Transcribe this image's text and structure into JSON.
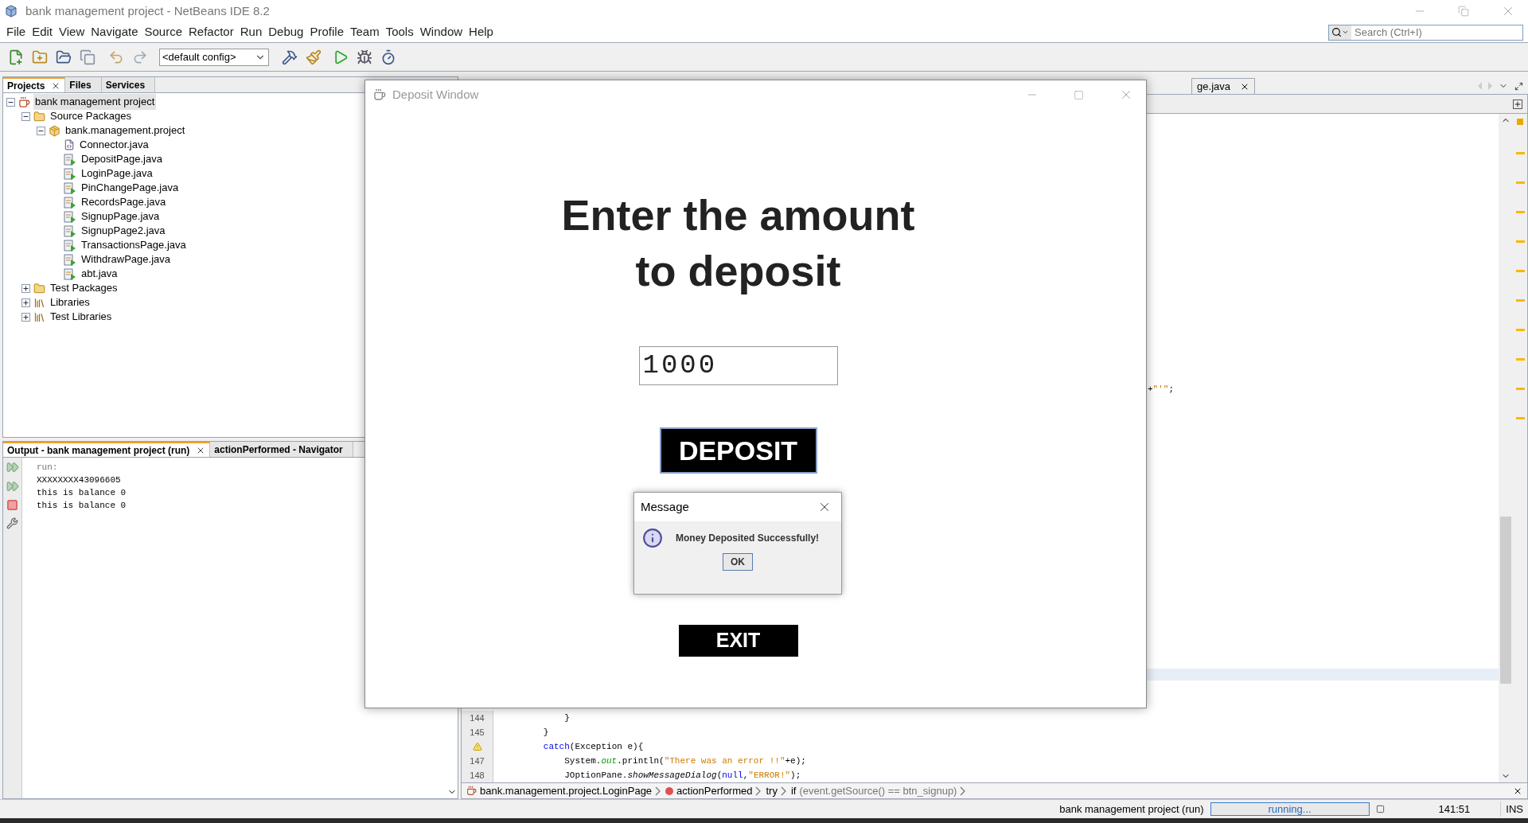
{
  "window": {
    "title": "bank management project - NetBeans IDE 8.2"
  },
  "menu": [
    "File",
    "Edit",
    "View",
    "Navigate",
    "Source",
    "Refactor",
    "Run",
    "Debug",
    "Profile",
    "Team",
    "Tools",
    "Window",
    "Help"
  ],
  "search": {
    "placeholder": "Search (Ctrl+I)"
  },
  "toolbar": {
    "config": "<default config>"
  },
  "projects_panel": {
    "tabs": [
      {
        "label": "Projects",
        "selected": true
      },
      {
        "label": "Files",
        "selected": false
      },
      {
        "label": "Services",
        "selected": false
      }
    ],
    "tree": [
      {
        "label": "bank management project",
        "kind": "project",
        "selected": true,
        "expanded": true,
        "children": [
          {
            "label": "Source Packages",
            "kind": "source-folder",
            "selected": false,
            "expanded": true,
            "children": [
              {
                "label": "bank.management.project",
                "kind": "package",
                "selected": false,
                "expanded": true,
                "children": [
                  {
                    "label": "Connector.java",
                    "kind": "class",
                    "selected": false
                  },
                  {
                    "label": "DepositPage.java",
                    "kind": "main-class",
                    "selected": false
                  },
                  {
                    "label": "LoginPage.java",
                    "kind": "main-class",
                    "selected": false
                  },
                  {
                    "label": "PinChangePage.java",
                    "kind": "main-class",
                    "selected": false
                  },
                  {
                    "label": "RecordsPage.java",
                    "kind": "main-class",
                    "selected": false
                  },
                  {
                    "label": "SignupPage.java",
                    "kind": "main-class",
                    "selected": false
                  },
                  {
                    "label": "SignupPage2.java",
                    "kind": "main-class",
                    "selected": false
                  },
                  {
                    "label": "TransactionsPage.java",
                    "kind": "main-class",
                    "selected": false
                  },
                  {
                    "label": "WithdrawPage.java",
                    "kind": "main-class",
                    "selected": false
                  },
                  {
                    "label": "abt.java",
                    "kind": "main-class",
                    "selected": false
                  }
                ]
              }
            ]
          },
          {
            "label": "Test Packages",
            "kind": "source-folder",
            "selected": false,
            "expanded": false
          },
          {
            "label": "Libraries",
            "kind": "library",
            "selected": false,
            "expanded": false
          },
          {
            "label": "Test Libraries",
            "kind": "library",
            "selected": false,
            "expanded": false
          }
        ]
      }
    ]
  },
  "output_panel": {
    "tabs": [
      {
        "label": "Output - bank management project (run)",
        "selected": true
      },
      {
        "label": "actionPerformed - Navigator",
        "selected": false
      }
    ],
    "lines": [
      {
        "text": "run:",
        "kind": "system"
      },
      {
        "text": "XXXXXXXX43096605",
        "kind": "out"
      },
      {
        "text": "this is balance 0",
        "kind": "out"
      },
      {
        "text": "this is balance 0",
        "kind": "out"
      }
    ]
  },
  "editor": {
    "tab": {
      "label": "ge.java"
    },
    "fragment": [
      {
        "text": "+",
        "kind": "plain"
      },
      {
        "text": "\"'\"",
        "kind": "string"
      },
      {
        "text": ";",
        "kind": "plain"
      }
    ],
    "lines": [
      {
        "number": "144",
        "segments": [
          {
            "text": "            }",
            "kind": "plain"
          }
        ]
      },
      {
        "number": "145",
        "segments": [
          {
            "text": "        }",
            "kind": "plain"
          }
        ]
      },
      {
        "warning": true,
        "segments": [
          {
            "text": "        catch",
            "kind": "keyword"
          },
          {
            "text": "(Exception e){",
            "kind": "plain"
          }
        ]
      },
      {
        "number": "147",
        "segments": [
          {
            "text": "            System.",
            "kind": "plain"
          },
          {
            "text": "out",
            "kind": "field"
          },
          {
            "text": ".println(",
            "kind": "plain"
          },
          {
            "text": "\"There was an error !!\"",
            "kind": "string"
          },
          {
            "text": "+e);",
            "kind": "plain"
          }
        ]
      },
      {
        "number": "148",
        "segments": [
          {
            "text": "            JOptionPane.",
            "kind": "plain"
          },
          {
            "text": "showMessageDialog",
            "kind": "static"
          },
          {
            "text": "(",
            "kind": "plain"
          },
          {
            "text": "null",
            "kind": "keyword"
          },
          {
            "text": ",",
            "kind": "plain"
          },
          {
            "text": "\"ERROR!\"",
            "kind": "string"
          },
          {
            "text": ");",
            "kind": "plain"
          }
        ]
      }
    ],
    "breadcrumbs": [
      {
        "label": "bank.management.project.LoginPage",
        "kind": "class"
      },
      {
        "label": "actionPerformed",
        "kind": "method"
      },
      {
        "label": "try",
        "kind": "block"
      },
      {
        "label": "if",
        "detail": "(event.getSource() == btn_signup)",
        "kind": "block"
      }
    ]
  },
  "deposit_window": {
    "title": "Deposit Window",
    "heading": [
      "Enter the amount",
      "to deposit"
    ],
    "amount": "1000",
    "deposit_button": "DEPOSIT",
    "exit_button": "EXIT"
  },
  "message_dialog": {
    "title": "Message",
    "text": "Money Deposited Successfully!",
    "ok": "OK"
  },
  "status_bar": {
    "task": "bank management project (run)",
    "progress": "running...",
    "position": "141:51",
    "mode": "INS"
  }
}
